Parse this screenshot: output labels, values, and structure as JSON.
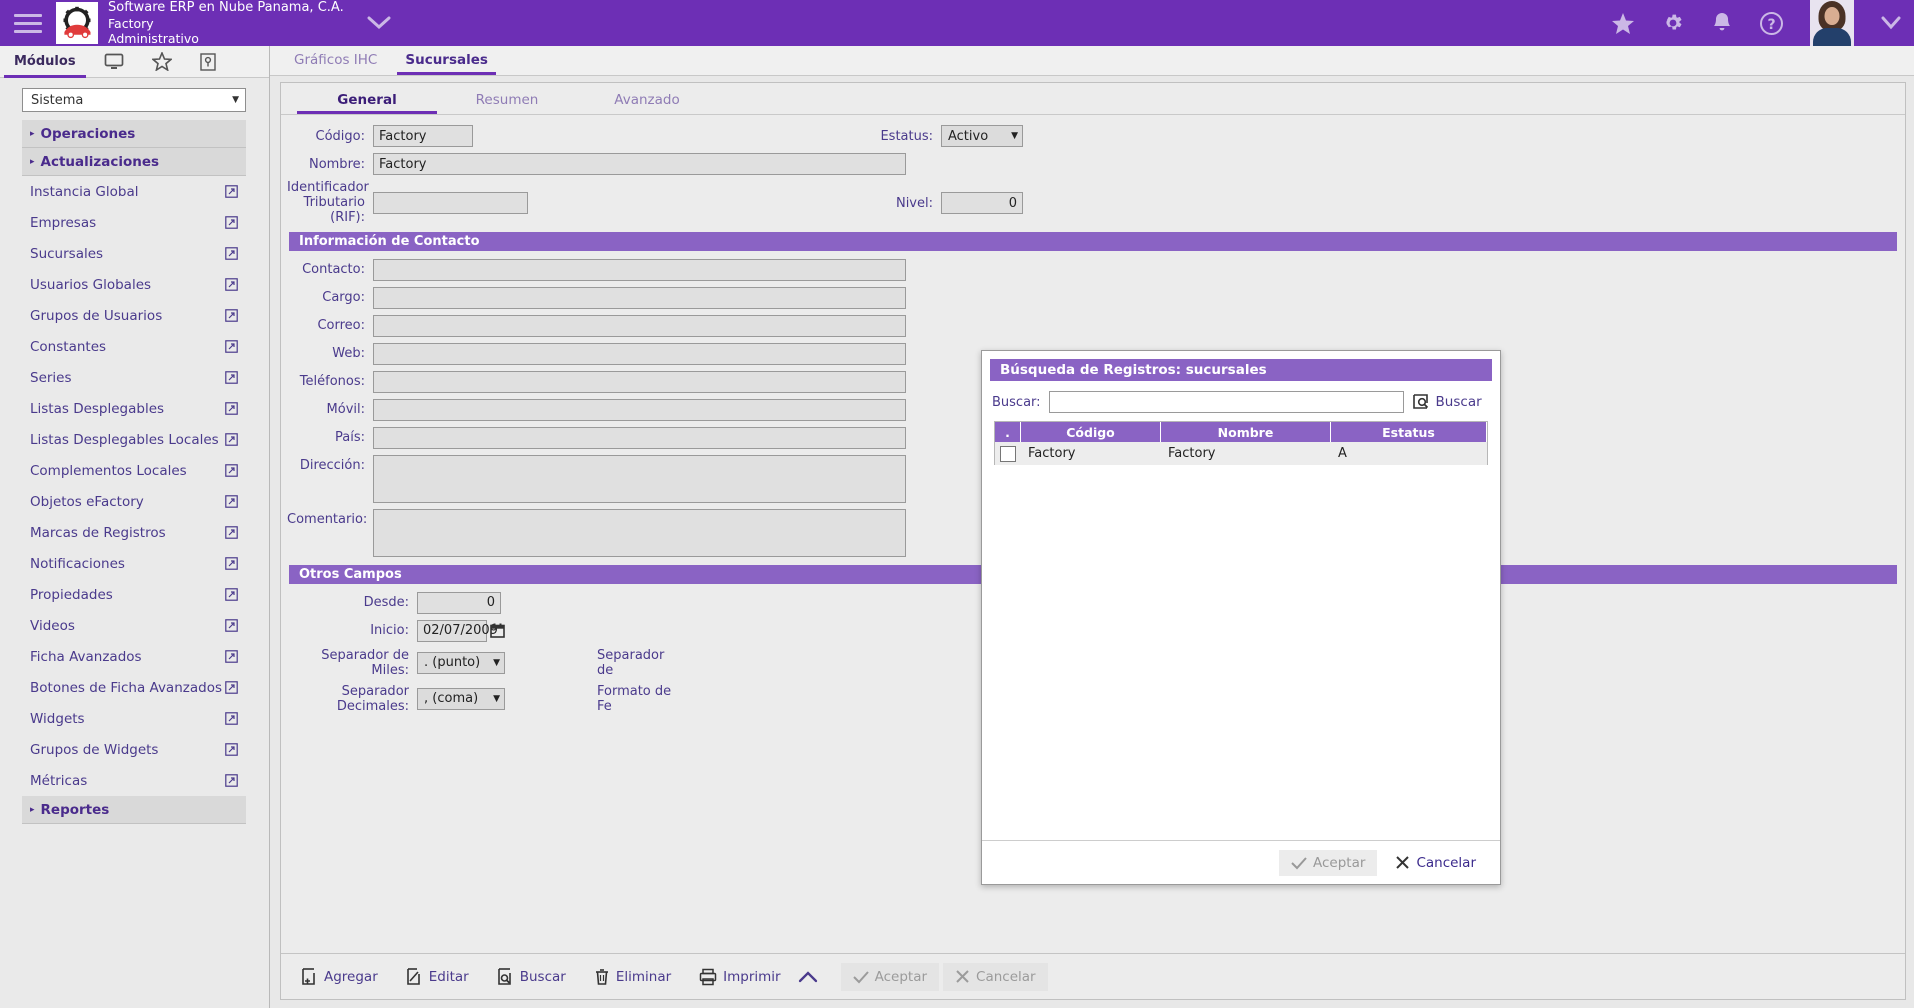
{
  "header": {
    "menu_icon": "hamburger-icon",
    "logo_icon": "factory-car-logo",
    "company": "Software ERP en Nube Panama, C.A.",
    "branch": "Factory",
    "role": "Administrativo",
    "expand_icon": "chevron-down-icon",
    "icons": [
      "star-icon",
      "gear-icon",
      "bell-icon",
      "help-icon"
    ],
    "avatar": "user-avatar",
    "collapse_icon": "chevron-down-icon",
    "bar_color": "#6d2fb5"
  },
  "sidebar": {
    "tabs": [
      {
        "label": "Módulos",
        "icon": "",
        "active": true
      },
      {
        "label": "",
        "icon": "monitor-icon",
        "active": false
      },
      {
        "label": "",
        "icon": "star-icon",
        "active": false
      },
      {
        "label": "",
        "icon": "key-icon",
        "active": false
      }
    ],
    "selector": {
      "value": "Sistema",
      "arrow": "▼"
    },
    "groups": [
      {
        "label": "Operaciones",
        "arrow": "▸"
      },
      {
        "label": "Actualizaciones",
        "arrow": "▸"
      }
    ],
    "items": [
      {
        "label": "Instancia Global"
      },
      {
        "label": "Empresas"
      },
      {
        "label": "Sucursales"
      },
      {
        "label": "Usuarios Globales"
      },
      {
        "label": "Grupos de Usuarios"
      },
      {
        "label": "Constantes"
      },
      {
        "label": "Series"
      },
      {
        "label": "Listas Desplegables"
      },
      {
        "label": "Listas Desplegables Locales"
      },
      {
        "label": "Complementos Locales"
      },
      {
        "label": "Objetos eFactory"
      },
      {
        "label": "Marcas de Registros"
      },
      {
        "label": "Notificaciones"
      },
      {
        "label": "Propiedades"
      },
      {
        "label": "Videos"
      },
      {
        "label": "Ficha Avanzados"
      },
      {
        "label": "Botones de Ficha Avanzados"
      },
      {
        "label": "Widgets"
      },
      {
        "label": "Grupos de Widgets"
      },
      {
        "label": "Métricas"
      }
    ],
    "footer_group": {
      "label": "Reportes",
      "arrow": "▸"
    }
  },
  "main": {
    "tabs": [
      {
        "label": "Gráficos IHC",
        "active": false
      },
      {
        "label": "Sucursales",
        "active": true
      }
    ],
    "form_tabs": [
      {
        "label": "General",
        "active": true
      },
      {
        "label": "Resumen",
        "active": false
      },
      {
        "label": "Avanzado",
        "active": false
      }
    ],
    "fields": {
      "codigo_label": "Código:",
      "codigo_value": "Factory",
      "nombre_label": "Nombre:",
      "nombre_value": "Factory",
      "rif_label_line1": "Identificador",
      "rif_label_line2": "Tributario (RIF):",
      "rif_value": "",
      "estatus_label": "Estatus:",
      "estatus_value": "Activo",
      "nivel_label": "Nivel:",
      "nivel_value": "0"
    },
    "contacto_section": "Información de Contacto",
    "contacto_fields": [
      {
        "label": "Contacto:",
        "value": ""
      },
      {
        "label": "Cargo:",
        "value": ""
      },
      {
        "label": "Correo:",
        "value": ""
      },
      {
        "label": "Web:",
        "value": ""
      },
      {
        "label": "Teléfonos:",
        "value": ""
      },
      {
        "label": "Móvil:",
        "value": ""
      },
      {
        "label": "País:",
        "value": ""
      }
    ],
    "direccion_label": "Dirección:",
    "direccion_value": "",
    "comentario_label": "Comentario:",
    "comentario_value": "",
    "otros_section": "Otros Campos",
    "otros_fields": {
      "desde_label": "Desde:",
      "desde_value": "0",
      "inicio_label": "Inicio:",
      "inicio_value": "02/07/2009",
      "calendar_icon": "calendar-icon",
      "sep_miles_label": "Separador de Miles:",
      "sep_miles_value": ". (punto)",
      "sep_dec_label": "Separador Decimales:",
      "sep_dec_value": ", (coma)",
      "right_label_1": "Separador de",
      "right_label_2": "Formato de Fe"
    }
  },
  "modal": {
    "title": "Búsqueda de Registros: sucursales",
    "search_label": "Buscar:",
    "search_value": "",
    "search_button": "Buscar",
    "search_icon": "search-icon",
    "columns": [
      ".",
      "Código",
      "Nombre",
      "Estatus"
    ],
    "rows": [
      {
        "checked": false,
        "codigo": "Factory",
        "nombre": "Factory",
        "estatus": "A"
      }
    ],
    "accept_button": "Aceptar",
    "cancel_button": "Cancelar",
    "accept_icon": "check-icon",
    "cancel_icon": "x-icon"
  },
  "toolbar": {
    "buttons": [
      {
        "label": "Agregar",
        "icon": "add-doc-icon",
        "disabled": false
      },
      {
        "label": "Editar",
        "icon": "edit-doc-icon",
        "disabled": false
      },
      {
        "label": "Buscar",
        "icon": "search-doc-icon",
        "disabled": false
      },
      {
        "label": "Eliminar",
        "icon": "trash-icon",
        "disabled": false
      },
      {
        "label": "Imprimir",
        "icon": "printer-icon",
        "disabled": false
      }
    ],
    "expand_icon": "chevron-up-icon",
    "accept_label": "Aceptar",
    "accept_icon": "check-icon",
    "cancel_label": "Cancelar",
    "cancel_icon": "x-icon"
  }
}
